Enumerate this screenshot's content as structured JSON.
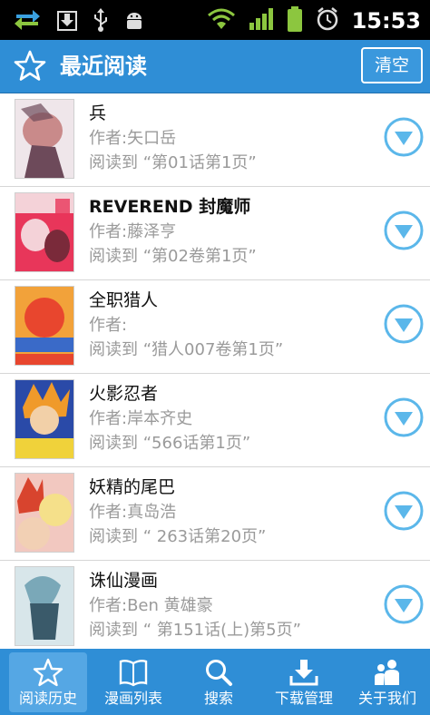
{
  "status_bar": {
    "time": "15:53",
    "icons": [
      "sync-transfer-icon",
      "download-icon",
      "usb-icon",
      "android-debug-icon",
      "wifi-icon",
      "signal-icon",
      "battery-icon",
      "alarm-icon"
    ]
  },
  "header": {
    "title": "最近阅读",
    "clear_label": "清空",
    "icon": "star-icon"
  },
  "list": {
    "items": [
      {
        "title": "兵",
        "author": "作者:矢口岳",
        "progress": "阅读到 “第01话第1页”",
        "cover_colors": [
          "#efe6ea",
          "#c98a8a",
          "#6d4a5a"
        ]
      },
      {
        "title": "REVEREND 封魔师",
        "author": "作者:藤泽亨",
        "progress": "阅读到 “第02卷第1页”",
        "cover_colors": [
          "#e8365a",
          "#f4d2d8",
          "#7a2a3a"
        ]
      },
      {
        "title": "全职猎人",
        "author": "作者:",
        "progress": "阅读到 “猎人007卷第1页”",
        "cover_colors": [
          "#f2a23a",
          "#e8462e",
          "#3a6ac8"
        ]
      },
      {
        "title": "火影忍者",
        "author": "作者:岸本齐史",
        "progress": "阅读到 “566话第1页”",
        "cover_colors": [
          "#f09a2a",
          "#2a4aa8",
          "#f0d23a"
        ]
      },
      {
        "title": "妖精的尾巴",
        "author": "作者:真岛浩",
        "progress": "阅读到 “ 263话第20页”",
        "cover_colors": [
          "#f2c8c0",
          "#d8442e",
          "#f5e08a"
        ]
      },
      {
        "title": "诛仙漫画",
        "author": "作者:Ben 黄雄豪",
        "progress": "阅读到 “ 第151话(上)第5页”",
        "cover_colors": [
          "#d8e6ea",
          "#7aa8b8",
          "#3a5a6a"
        ]
      }
    ]
  },
  "tabbar": {
    "tabs": [
      {
        "label": "阅读历史",
        "icon": "star-icon",
        "active": true
      },
      {
        "label": "漫画列表",
        "icon": "book-icon",
        "active": false
      },
      {
        "label": "搜索",
        "icon": "search-icon",
        "active": false
      },
      {
        "label": "下载管理",
        "icon": "download-icon",
        "active": false
      },
      {
        "label": "关于我们",
        "icon": "people-icon",
        "active": false
      }
    ]
  },
  "colors": {
    "accent": "#2f8ed6",
    "expand_icon": "#5bb7ea",
    "secondary_text": "#9a9a9a"
  }
}
